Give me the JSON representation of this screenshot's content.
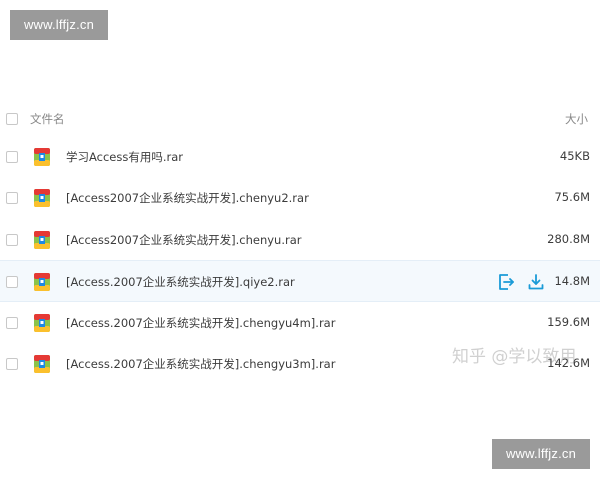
{
  "watermark": {
    "text": "www.lffjz.cn"
  },
  "header": {
    "name_label": "文件名",
    "size_label": "大小"
  },
  "files": [
    {
      "name": "学习Access有用吗.rar",
      "size": "45KB"
    },
    {
      "name": "[Access2007企业系统实战开发].chenyu2.rar",
      "size": "75.6M"
    },
    {
      "name": "[Access2007企业系统实战开发].chenyu.rar",
      "size": "280.8M"
    },
    {
      "name": "[Access.2007企业系统实战开发].qiye2.rar",
      "size": "14.8M"
    },
    {
      "name": "[Access.2007企业系统实战开发].chengyu4m].rar",
      "size": "159.6M"
    },
    {
      "name": "[Access.2007企业系统实战开发].chengyu3m].rar",
      "size": "142.6M"
    }
  ],
  "row_actions": {
    "share_icon": "share-icon",
    "download_icon": "download-icon"
  },
  "file_icon": "rar-archive-icon",
  "zhihu_watermark": "知乎 @学以致用",
  "colors": {
    "accent": "#1a9bd7",
    "hover_row": "#f4f9fd",
    "watermark_bg": "#9a9a9a"
  }
}
